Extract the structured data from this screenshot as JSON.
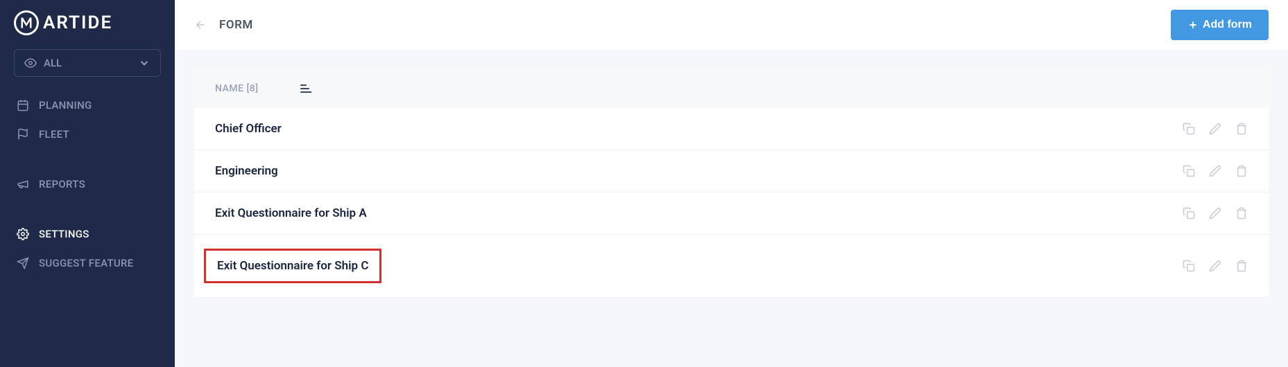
{
  "brand": {
    "name": "ARTIDE"
  },
  "sidebar": {
    "filter_label": "ALL",
    "items": [
      {
        "label": "PLANNING"
      },
      {
        "label": "FLEET"
      },
      {
        "label": "REPORTS"
      },
      {
        "label": "SETTINGS"
      },
      {
        "label": "SUGGEST FEATURE"
      }
    ]
  },
  "header": {
    "title": "FORM",
    "add_button_label": "Add form"
  },
  "table": {
    "header_label": "NAME [8]",
    "rows": [
      {
        "name": "Chief Officer",
        "highlighted": false
      },
      {
        "name": "Engineering",
        "highlighted": false
      },
      {
        "name": "Exit Questionnaire for Ship A",
        "highlighted": false
      },
      {
        "name": "Exit Questionnaire for Ship C",
        "highlighted": true
      }
    ]
  }
}
